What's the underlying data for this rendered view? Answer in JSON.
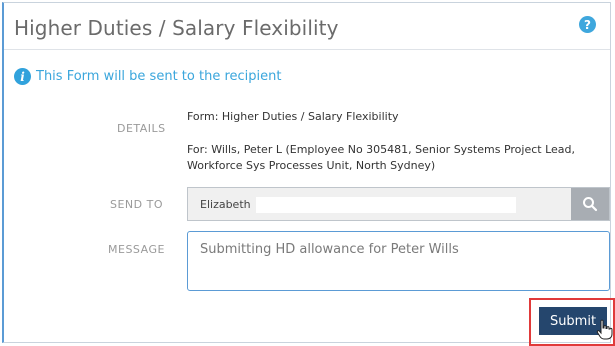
{
  "dialog": {
    "title": "Higher Duties / Salary Flexibility",
    "help_icon": "question-circle-icon",
    "notice": {
      "icon": "info-circle-icon",
      "text": "This Form will be sent to the recipient"
    }
  },
  "details": {
    "label": "DETAILS",
    "form_line": "Form: Higher Duties / Salary Flexibility",
    "for_line_1": "For: Wills, Peter L (Employee No 305481, Senior Systems Project Lead,",
    "for_line_2": "Workforce Sys Processes Unit, North Sydney)"
  },
  "send_to": {
    "label": "SEND TO",
    "value": "Elizabeth",
    "search_icon": "search-icon"
  },
  "message": {
    "label": "MESSAGE",
    "value": "Submitting HD allowance for Peter Wills"
  },
  "actions": {
    "submit_label": "Submit"
  },
  "colors": {
    "accent": "#3aa6dc",
    "submit": "#25466d",
    "highlight": "#e03a3a"
  }
}
